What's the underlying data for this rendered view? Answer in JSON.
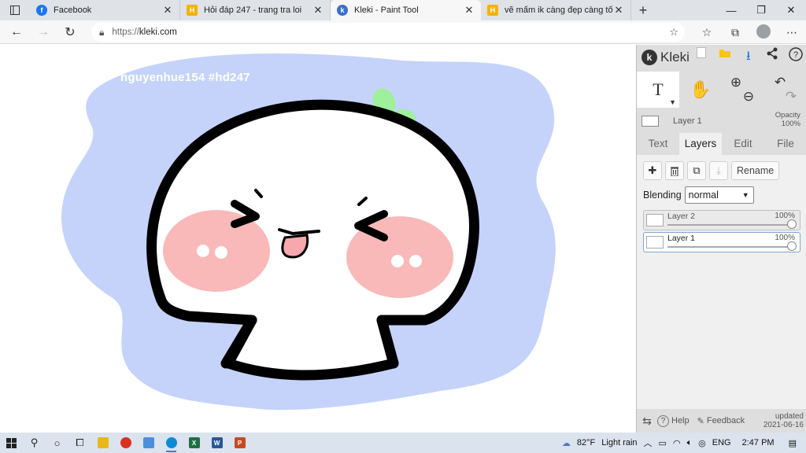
{
  "browser": {
    "tabs": [
      {
        "title": "Facebook",
        "fav_color": "#1877f2",
        "fav_glyph": "f",
        "active": false
      },
      {
        "title": "Hỏi đáp 247 - trang tra loi",
        "fav_color": "#f5b300",
        "fav_glyph": "H",
        "active": false
      },
      {
        "title": "Kleki - Paint Tool",
        "fav_color": "#3b6fd1",
        "fav_glyph": "k",
        "active": true
      },
      {
        "title": "vẽ mấm ik càng đẹp càng tốt cà",
        "fav_color": "#f5b300",
        "fav_glyph": "H",
        "active": false
      }
    ],
    "close_glyph": "✕",
    "newtab_glyph": "+",
    "url_scheme": "https://",
    "url_host": "kleki.com"
  },
  "canvas": {
    "watermark": "nguyenhue154 #hd247",
    "colors": {
      "background_blob": "#c5d3fb",
      "outline": "#000000",
      "face": "#ffffff",
      "blush": "#f7a1a1",
      "sprout": "#9ef09c",
      "tongue": "#f7a8ad"
    }
  },
  "kleki": {
    "logo_letter": "k",
    "logo_text": "Kleki",
    "active_tool_glyph": "T",
    "hand_glyph": "✋",
    "zoom_in_glyph": "⊕",
    "zoom_out_glyph": "⊖",
    "undo_glyph": "↶",
    "redo_glyph": "↷",
    "current_layer_name": "Layer 1",
    "opacity_label": "Opacity",
    "opacity_value": "100%",
    "tabs": [
      "Text",
      "Layers",
      "Edit",
      "File"
    ],
    "active_tab": "Layers",
    "rename_label": "Rename",
    "blending_label": "Blending",
    "blending_value": "normal",
    "layers": [
      {
        "name": "Layer 2",
        "opacity": "100%",
        "active": false
      },
      {
        "name": "Layer 1",
        "opacity": "100%",
        "active": true
      }
    ],
    "help_label": "Help",
    "feedback_label": "Feedback",
    "updated_label": "updated",
    "updated_date": "2021-06-16"
  },
  "taskbar": {
    "weather_temp": "82°F",
    "weather_text": "Light rain",
    "language": "ENG",
    "time": "2:47 PM"
  }
}
